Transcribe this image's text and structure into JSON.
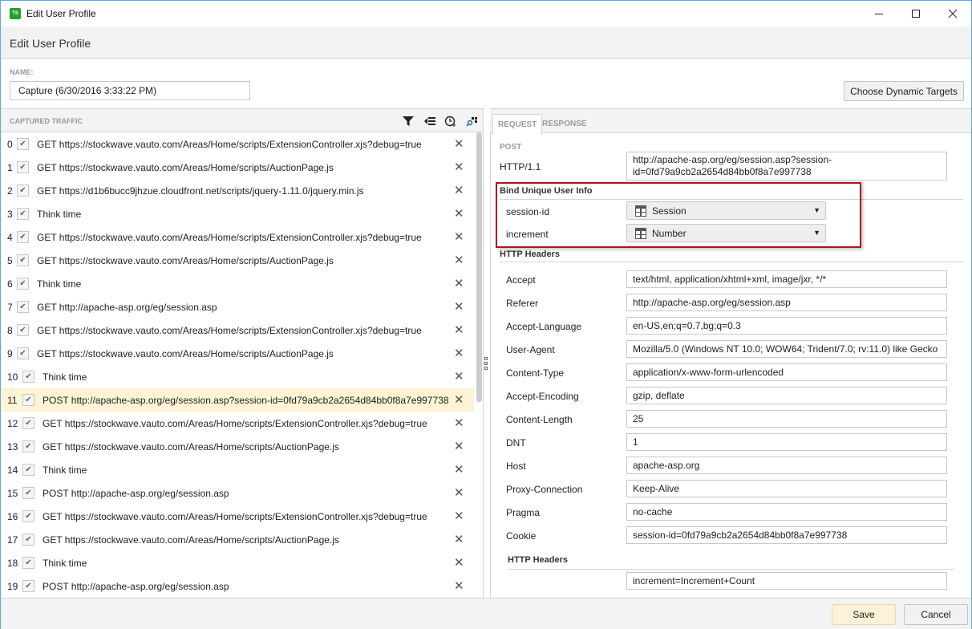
{
  "window": {
    "title": "Edit User Profile",
    "app_icon_text": "TS"
  },
  "header": {
    "title": "Edit User Profile"
  },
  "name_section": {
    "label": "NAME:",
    "value": "Capture (6/30/2016 3:33:22 PM)"
  },
  "choose_dynamic_targets_label": "Choose Dynamic Targets",
  "captured_traffic": {
    "label": "CAPTURED TRAFFIC",
    "toolbar_icons": [
      "filter-icon",
      "list-toggle-icon",
      "add-timer-icon",
      "search-binding-icon"
    ],
    "selected_index": 11,
    "rows": [
      {
        "index": "0",
        "text": "GET https://stockwave.vauto.com/Areas/Home/scripts/ExtensionController.xjs?debug=true",
        "checked": true
      },
      {
        "index": "1",
        "text": "GET https://stockwave.vauto.com/Areas/Home/scripts/AuctionPage.js",
        "checked": true
      },
      {
        "index": "2",
        "text": "GET https://d1b6bucc9jhzue.cloudfront.net/scripts/jquery-1.11.0/jquery.min.js",
        "checked": true
      },
      {
        "index": "3",
        "text": "Think time",
        "checked": true
      },
      {
        "index": "4",
        "text": "GET https://stockwave.vauto.com/Areas/Home/scripts/ExtensionController.xjs?debug=true",
        "checked": true
      },
      {
        "index": "5",
        "text": "GET https://stockwave.vauto.com/Areas/Home/scripts/AuctionPage.js",
        "checked": true
      },
      {
        "index": "6",
        "text": "Think time",
        "checked": true
      },
      {
        "index": "7",
        "text": "GET http://apache-asp.org/eg/session.asp",
        "checked": true
      },
      {
        "index": "8",
        "text": "GET https://stockwave.vauto.com/Areas/Home/scripts/ExtensionController.xjs?debug=true",
        "checked": true
      },
      {
        "index": "9",
        "text": "GET https://stockwave.vauto.com/Areas/Home/scripts/AuctionPage.js",
        "checked": true
      },
      {
        "index": "10",
        "text": "Think time",
        "checked": true
      },
      {
        "index": "11",
        "text": "POST http://apache-asp.org/eg/session.asp?session-id=0fd79a9cb2a2654d84bb0f8a7e997738",
        "checked": true
      },
      {
        "index": "12",
        "text": "GET https://stockwave.vauto.com/Areas/Home/scripts/ExtensionController.xjs?debug=true",
        "checked": true
      },
      {
        "index": "13",
        "text": "GET https://stockwave.vauto.com/Areas/Home/scripts/AuctionPage.js",
        "checked": true
      },
      {
        "index": "14",
        "text": "Think time",
        "checked": true
      },
      {
        "index": "15",
        "text": "POST http://apache-asp.org/eg/session.asp",
        "checked": true
      },
      {
        "index": "16",
        "text": "GET https://stockwave.vauto.com/Areas/Home/scripts/ExtensionController.xjs?debug=true",
        "checked": true
      },
      {
        "index": "17",
        "text": "GET https://stockwave.vauto.com/Areas/Home/scripts/AuctionPage.js",
        "checked": true
      },
      {
        "index": "18",
        "text": "Think time",
        "checked": true
      },
      {
        "index": "19",
        "text": "POST http://apache-asp.org/eg/session.asp",
        "checked": true
      }
    ]
  },
  "detail": {
    "tabs": [
      {
        "label": "REQUEST",
        "active": true
      },
      {
        "label": "RESPONSE",
        "active": false
      }
    ],
    "method": "POST",
    "protocol": "HTTP/1.1",
    "url": "http://apache-asp.org/eg/session.asp?session-id=0fd79a9cb2a2654d84bb0f8a7e997738",
    "bind_section": {
      "title": "Bind Unique User Info",
      "rows": [
        {
          "label": "session-id",
          "value": "Session"
        },
        {
          "label": "increment",
          "value": "Number"
        }
      ]
    },
    "headers_title": "HTTP Headers",
    "headers": [
      {
        "name": "Accept",
        "value": "text/html, application/xhtml+xml, image/jxr, */*"
      },
      {
        "name": "Referer",
        "value": "http://apache-asp.org/eg/session.asp"
      },
      {
        "name": "Accept-Language",
        "value": "en-US,en;q=0.7,bg;q=0.3"
      },
      {
        "name": "User-Agent",
        "value": "Mozilla/5.0 (Windows NT 10.0; WOW64; Trident/7.0; rv:11.0) like Gecko"
      },
      {
        "name": "Content-Type",
        "value": "application/x-www-form-urlencoded"
      },
      {
        "name": "Accept-Encoding",
        "value": "gzip, deflate"
      },
      {
        "name": "Content-Length",
        "value": "25"
      },
      {
        "name": "DNT",
        "value": "1"
      },
      {
        "name": "Host",
        "value": "apache-asp.org"
      },
      {
        "name": "Proxy-Connection",
        "value": "Keep-Alive"
      },
      {
        "name": "Pragma",
        "value": "no-cache"
      },
      {
        "name": "Cookie",
        "value": "session-id=0fd79a9cb2a2654d84bb0f8a7e997738"
      }
    ],
    "body_title": "HTTP Headers",
    "body_value": "increment=Increment+Count"
  },
  "footer": {
    "save_label": "Save",
    "cancel_label": "Cancel"
  },
  "colors": {
    "selection": "#fdf4d6",
    "highlight_border": "#b0141c",
    "app_icon": "#1fa32b",
    "save_button": "#fdf1d8"
  }
}
